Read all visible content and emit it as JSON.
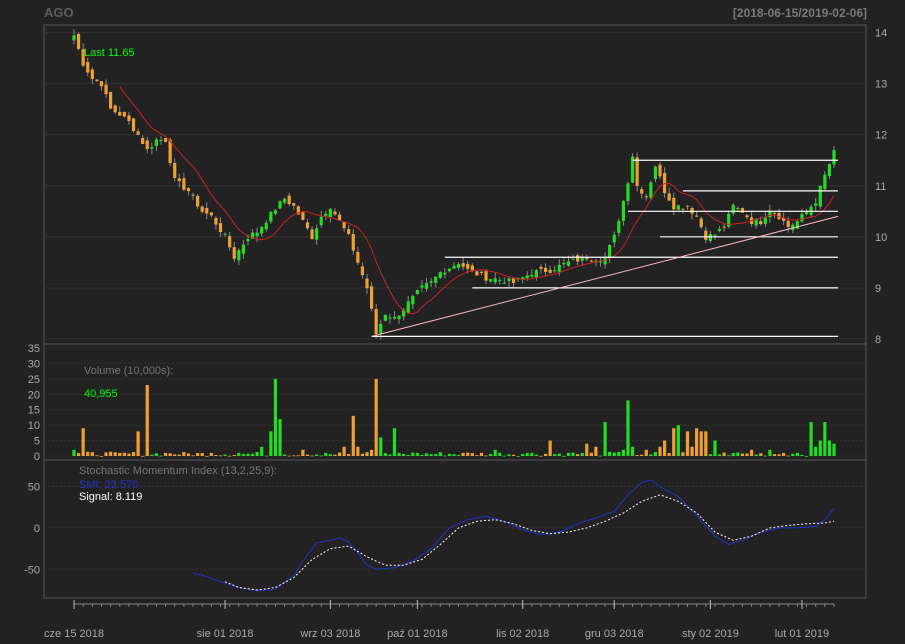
{
  "header": {
    "symbol": "AGO",
    "date_range": "[2018-06-15/2019-02-06]"
  },
  "colors": {
    "background": "#222222",
    "panel_border": "#555555",
    "grid": "#333333",
    "up": "#22dd22",
    "down": "#f0a030",
    "sma": "#cc2222",
    "trendline": "#ffb6c1",
    "hline": "#ffffff",
    "smi": "#2233cc",
    "signal": "#ffffff",
    "label_green": "#00ff00",
    "axis_text": "#aaaaaa"
  },
  "price_panel": {
    "last_label": "Last 11.65",
    "y_ticks": [
      "14",
      "13",
      "12",
      "11",
      "10",
      "9",
      "8"
    ],
    "y_range": [
      7.9,
      14.15
    ]
  },
  "volume_panel": {
    "label": "Volume (10,000s):",
    "value_label": "40,955",
    "y_ticks": [
      "35",
      "30",
      "25",
      "20",
      "15",
      "10",
      "5",
      "0"
    ],
    "y_range": [
      0,
      35
    ]
  },
  "smi_panel": {
    "title": "Stochastic Momentum Index (13,2,25,9):",
    "smi_label": "SMI: 23.570",
    "signal_label": "Signal: 8.119",
    "y_ticks": [
      "50",
      "0",
      "-50"
    ],
    "y_range": [
      -75,
      70
    ]
  },
  "x_axis": {
    "labels": [
      "cze 15 2018",
      "sie 01 2018",
      "wrz 03 2018",
      "paź 01 2018",
      "lis 02 2018",
      "gru 03 2018",
      "sty 02 2019",
      "lut 01 2019"
    ],
    "label_index": [
      0,
      33,
      56,
      75,
      98,
      118,
      139,
      159
    ]
  },
  "chart_data": {
    "type": "candlestick",
    "n_days": 167,
    "anchors": {
      "close": [
        [
          0,
          13.95
        ],
        [
          2,
          13.4
        ],
        [
          4,
          13.1
        ],
        [
          6,
          13.0
        ],
        [
          8,
          12.5
        ],
        [
          10,
          12.4
        ],
        [
          12,
          12.25
        ],
        [
          14,
          12.0
        ],
        [
          16,
          11.7
        ],
        [
          18,
          11.9
        ],
        [
          20,
          11.9
        ],
        [
          22,
          11.1
        ],
        [
          25,
          10.9
        ],
        [
          28,
          10.5
        ],
        [
          30,
          10.4
        ],
        [
          33,
          10.0
        ],
        [
          35,
          9.6
        ],
        [
          38,
          10.0
        ],
        [
          40,
          10.1
        ],
        [
          44,
          10.55
        ],
        [
          46,
          10.75
        ],
        [
          48,
          10.6
        ],
        [
          50,
          10.3
        ],
        [
          52,
          10.0
        ],
        [
          54,
          10.4
        ],
        [
          56,
          10.6
        ],
        [
          58,
          10.3
        ],
        [
          60,
          10.0
        ],
        [
          62,
          9.5
        ],
        [
          64,
          9.0
        ],
        [
          66,
          8.1
        ],
        [
          68,
          8.5
        ],
        [
          70,
          8.4
        ],
        [
          72,
          8.6
        ],
        [
          74,
          8.8
        ],
        [
          76,
          9.0
        ],
        [
          78,
          9.1
        ],
        [
          80,
          9.3
        ],
        [
          82,
          9.4
        ],
        [
          84,
          9.5
        ],
        [
          86,
          9.35
        ],
        [
          90,
          9.2
        ],
        [
          94,
          9.15
        ],
        [
          96,
          9.1
        ],
        [
          98,
          9.2
        ],
        [
          100,
          9.3
        ],
        [
          104,
          9.35
        ],
        [
          108,
          9.5
        ],
        [
          112,
          9.6
        ],
        [
          114,
          9.55
        ],
        [
          116,
          9.6
        ],
        [
          118,
          10.0
        ],
        [
          120,
          10.7
        ],
        [
          121,
          11.1
        ],
        [
          122,
          11.6
        ],
        [
          123,
          11.0
        ],
        [
          125,
          10.8
        ],
        [
          127,
          11.4
        ],
        [
          129,
          10.9
        ],
        [
          131,
          10.6
        ],
        [
          134,
          10.6
        ],
        [
          136,
          10.4
        ],
        [
          138,
          10.0
        ],
        [
          140,
          10.05
        ],
        [
          142,
          10.2
        ],
        [
          144,
          10.6
        ],
        [
          146,
          10.5
        ],
        [
          148,
          10.3
        ],
        [
          150,
          10.3
        ],
        [
          152,
          10.55
        ],
        [
          154,
          10.4
        ],
        [
          156,
          10.2
        ],
        [
          158,
          10.3
        ],
        [
          160,
          10.5
        ],
        [
          162,
          10.7
        ],
        [
          164,
          11.2
        ],
        [
          166,
          11.65
        ]
      ],
      "volume": [
        [
          0,
          2
        ],
        [
          2,
          9
        ],
        [
          10,
          1
        ],
        [
          14,
          8
        ],
        [
          16,
          23
        ],
        [
          20,
          1
        ],
        [
          30,
          1
        ],
        [
          36,
          1
        ],
        [
          41,
          3
        ],
        [
          43,
          8
        ],
        [
          44,
          25
        ],
        [
          45,
          12
        ],
        [
          50,
          2
        ],
        [
          55,
          1
        ],
        [
          59,
          3
        ],
        [
          61,
          13
        ],
        [
          62,
          3
        ],
        [
          65,
          2
        ],
        [
          66,
          25
        ],
        [
          67,
          6
        ],
        [
          70,
          9
        ],
        [
          75,
          1
        ],
        [
          85,
          1
        ],
        [
          92,
          2
        ],
        [
          99,
          1
        ],
        [
          104,
          5
        ],
        [
          108,
          1
        ],
        [
          112,
          4
        ],
        [
          114,
          3
        ],
        [
          116,
          11
        ],
        [
          120,
          2
        ],
        [
          121,
          18
        ],
        [
          122,
          3
        ],
        [
          125,
          2
        ],
        [
          128,
          3
        ],
        [
          129,
          5
        ],
        [
          131,
          9
        ],
        [
          132,
          10
        ],
        [
          134,
          8
        ],
        [
          135,
          3
        ],
        [
          136,
          9
        ],
        [
          137,
          8
        ],
        [
          138,
          8
        ],
        [
          140,
          5
        ],
        [
          144,
          1
        ],
        [
          148,
          2
        ],
        [
          152,
          2
        ],
        [
          155,
          1
        ],
        [
          158,
          1
        ],
        [
          161,
          11
        ],
        [
          162,
          3
        ],
        [
          163,
          5
        ],
        [
          164,
          11
        ],
        [
          165,
          5
        ],
        [
          166,
          4
        ],
        [
          167,
          4
        ]
      ],
      "smi": [
        [
          26,
          -55
        ],
        [
          28,
          -57
        ],
        [
          32,
          -65
        ],
        [
          36,
          -72
        ],
        [
          40,
          -76
        ],
        [
          44,
          -74
        ],
        [
          48,
          -58
        ],
        [
          50,
          -40
        ],
        [
          53,
          -18
        ],
        [
          56,
          -15
        ],
        [
          58,
          -12
        ],
        [
          60,
          -17
        ],
        [
          62,
          -30
        ],
        [
          64,
          -45
        ],
        [
          66,
          -50
        ],
        [
          70,
          -48
        ],
        [
          74,
          -40
        ],
        [
          78,
          -25
        ],
        [
          82,
          0
        ],
        [
          86,
          10
        ],
        [
          90,
          14
        ],
        [
          94,
          8
        ],
        [
          98,
          -2
        ],
        [
          102,
          -8
        ],
        [
          106,
          -5
        ],
        [
          110,
          5
        ],
        [
          114,
          12
        ],
        [
          118,
          20
        ],
        [
          121,
          40
        ],
        [
          124,
          55
        ],
        [
          126,
          58
        ],
        [
          128,
          50
        ],
        [
          132,
          38
        ],
        [
          136,
          15
        ],
        [
          140,
          -10
        ],
        [
          143,
          -20
        ],
        [
          146,
          -15
        ],
        [
          150,
          -5
        ],
        [
          154,
          0
        ],
        [
          158,
          0
        ],
        [
          162,
          2
        ],
        [
          164,
          10
        ],
        [
          166,
          23.57
        ]
      ],
      "signal": [
        [
          33,
          -65
        ],
        [
          36,
          -72
        ],
        [
          40,
          -75
        ],
        [
          44,
          -72
        ],
        [
          48,
          -60
        ],
        [
          52,
          -38
        ],
        [
          56,
          -25
        ],
        [
          60,
          -22
        ],
        [
          64,
          -35
        ],
        [
          68,
          -45
        ],
        [
          72,
          -45
        ],
        [
          76,
          -38
        ],
        [
          80,
          -20
        ],
        [
          84,
          0
        ],
        [
          88,
          8
        ],
        [
          92,
          10
        ],
        [
          96,
          5
        ],
        [
          100,
          -3
        ],
        [
          104,
          -7
        ],
        [
          108,
          -5
        ],
        [
          112,
          0
        ],
        [
          116,
          8
        ],
        [
          120,
          18
        ],
        [
          124,
          32
        ],
        [
          128,
          40
        ],
        [
          132,
          32
        ],
        [
          136,
          18
        ],
        [
          140,
          -5
        ],
        [
          144,
          -15
        ],
        [
          148,
          -10
        ],
        [
          152,
          0
        ],
        [
          156,
          3
        ],
        [
          160,
          5
        ],
        [
          164,
          6
        ],
        [
          166,
          8.119
        ]
      ]
    },
    "sma_start": 10,
    "horizontal_levels": [
      {
        "value": 11.5,
        "from": 122,
        "to": 166
      },
      {
        "value": 10.9,
        "from": 133,
        "to": 166
      },
      {
        "value": 10.5,
        "from": 121,
        "to": 166
      },
      {
        "value": 10.0,
        "from": 128,
        "to": 166
      },
      {
        "value": 9.6,
        "from": 81,
        "to": 166
      },
      {
        "value": 9.0,
        "from": 87,
        "to": 166
      },
      {
        "value": 8.05,
        "from": 65,
        "to": 166
      }
    ],
    "trendline": {
      "from": [
        65,
        8.05
      ],
      "to": [
        166,
        10.4
      ]
    }
  }
}
